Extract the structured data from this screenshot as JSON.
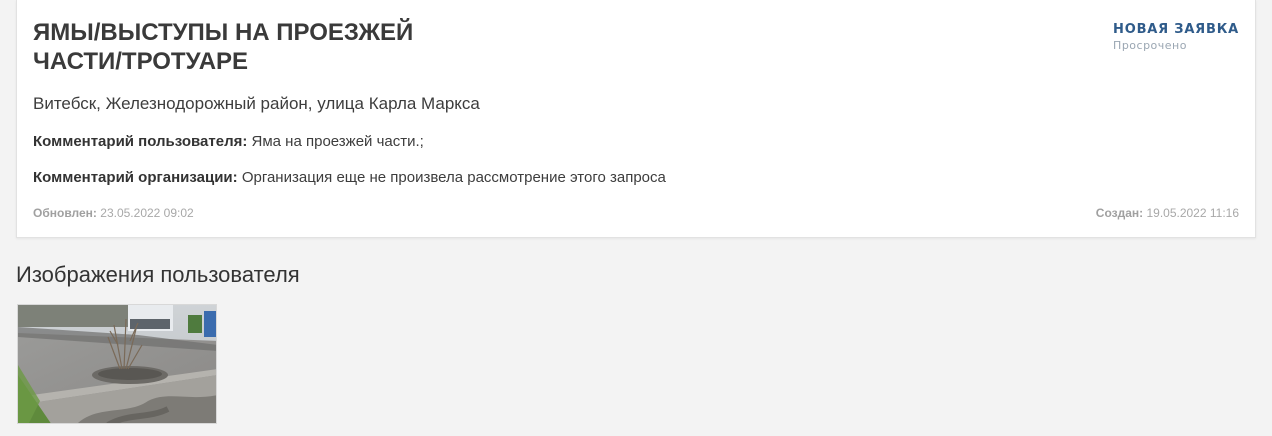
{
  "request": {
    "title": "Ямы/выступы на проезжей части/тротуаре",
    "status": "НОВАЯ ЗАЯВКА",
    "status_note": "Просрочено",
    "address": "Витебск, Железнодорожный район, улица Карла Маркса",
    "user_comment_label": "Комментарий пользователя:",
    "user_comment": "Яма на проезжей части.;",
    "org_comment_label": "Комментарий организации:",
    "org_comment": "Организация еще не произвела рассмотрение этого запроса",
    "updated_label": "Обновлен:",
    "updated_value": "23.05.2022 09:02",
    "created_label": "Создан:",
    "created_value": "19.05.2022 11:16"
  },
  "images_section": {
    "heading": "Изображения пользователя",
    "thumbnails": [
      {
        "name": "user-photo-thumbnail"
      }
    ]
  },
  "colors": {
    "status": "#2f5b8a",
    "status_note": "#9aa6b2",
    "page_bg": "#f3f3f3",
    "card_bg": "#ffffff"
  }
}
